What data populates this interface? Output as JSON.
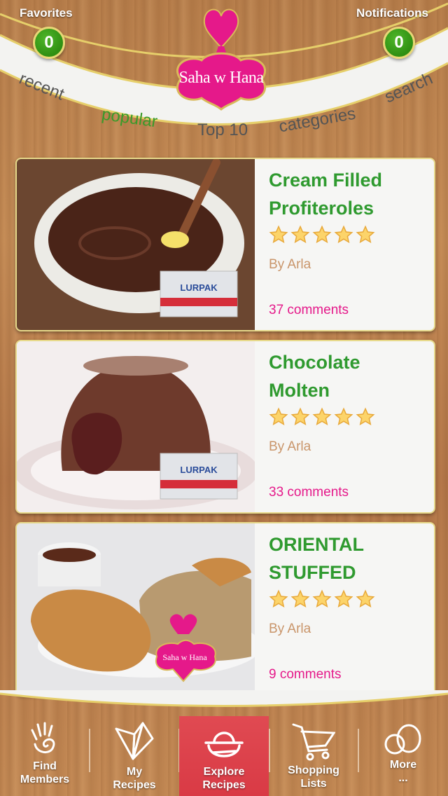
{
  "header": {
    "favorites_label": "Favorites",
    "favorites_count": "0",
    "notifications_label": "Notifications",
    "notifications_count": "0",
    "logo_text": "Saha w Hana",
    "tabs": [
      {
        "label": "recent",
        "active": false
      },
      {
        "label": "popular",
        "active": true
      },
      {
        "label": "Top 10",
        "active": false
      },
      {
        "label": "categories",
        "active": false
      },
      {
        "label": "search",
        "active": false
      }
    ]
  },
  "recipes": [
    {
      "title_line1": "Cream Filled",
      "title_line2": "Profiteroles",
      "rating": 5,
      "author": "By Arla",
      "comments": "37 comments",
      "image": "chocolate-sauce-bowl-with-lurpak"
    },
    {
      "title_line1": "Chocolate",
      "title_line2": "Molten",
      "rating": 5,
      "author": "By Arla",
      "comments": "33 comments",
      "image": "chocolate-lava-cake-with-lurpak"
    },
    {
      "title_line1": "ORIENTAL",
      "title_line2": "STUFFED",
      "rating": 5,
      "author": "By Arla",
      "comments": "9 comments",
      "image": "roast-chicken-with-rice"
    }
  ],
  "tabbar": {
    "items": [
      {
        "label_line1": "Find",
        "label_line2": "Members",
        "icon": "hand-icon",
        "active": false
      },
      {
        "label_line1": "My",
        "label_line2": "Recipes",
        "icon": "fan-icon",
        "active": false
      },
      {
        "label_line1": "Explore",
        "label_line2": "Recipes",
        "icon": "basket-icon",
        "active": true
      },
      {
        "label_line1": "Shopping",
        "label_line2": "Lists",
        "icon": "cart-icon",
        "active": false
      },
      {
        "label_line1": "More",
        "label_line2": "...",
        "icon": "more-icon",
        "active": false
      }
    ]
  },
  "colors": {
    "brand_pink": "#e5198a",
    "title_green": "#2f9a2f",
    "badge_green": "#2e8f12",
    "active_tab_red": "#d93a45",
    "author_tan": "#c9956a"
  }
}
